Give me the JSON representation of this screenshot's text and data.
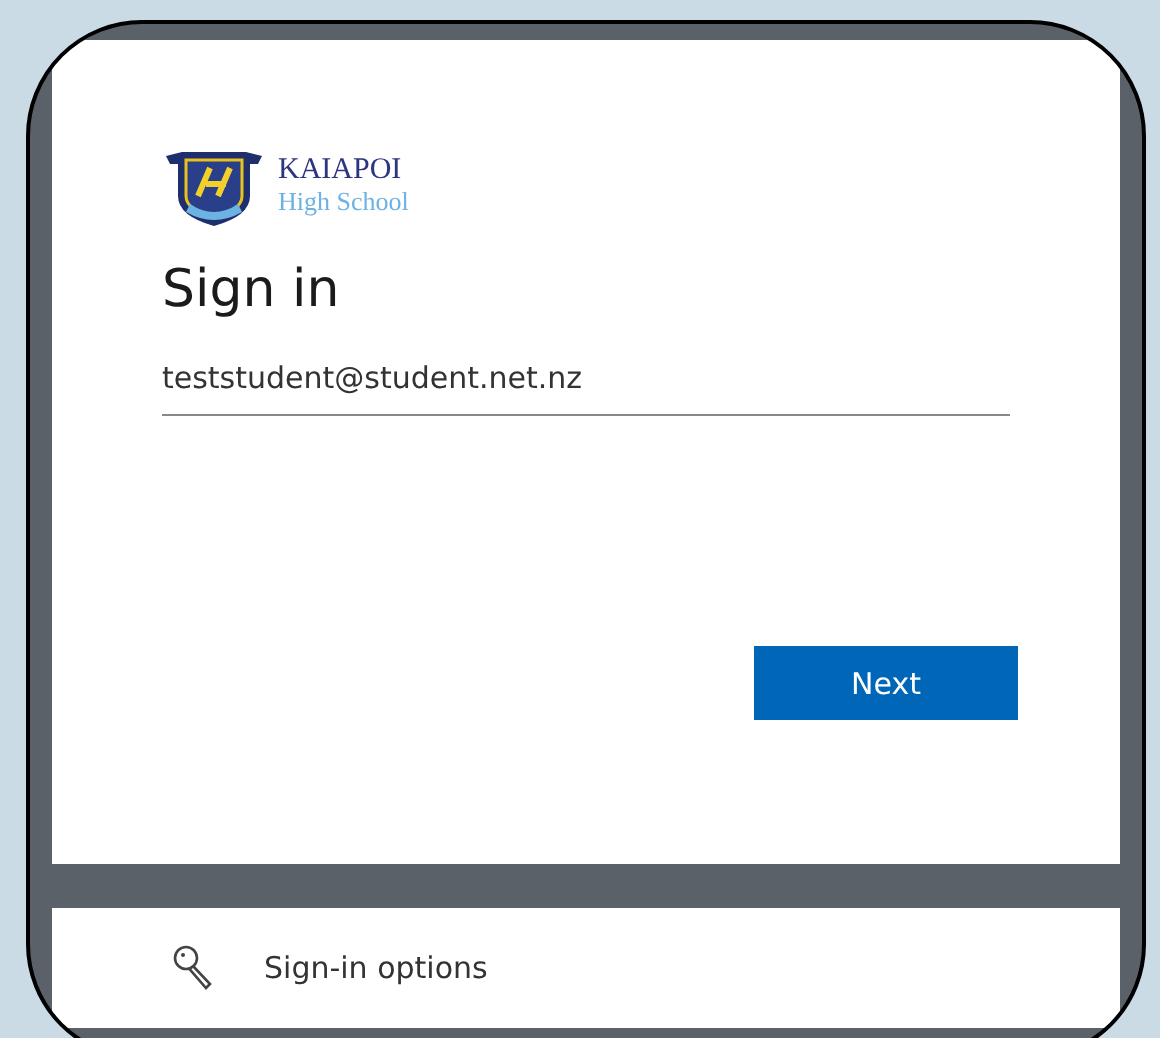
{
  "logo": {
    "name": "KAIAPOI",
    "subtitle": "High School"
  },
  "title": "Sign in",
  "email_field": {
    "value": "teststudent@student.net.nz"
  },
  "buttons": [
    {
      "label": "Next",
      "kind": "primary"
    }
  ],
  "footer": {
    "label": "Sign-in options"
  }
}
